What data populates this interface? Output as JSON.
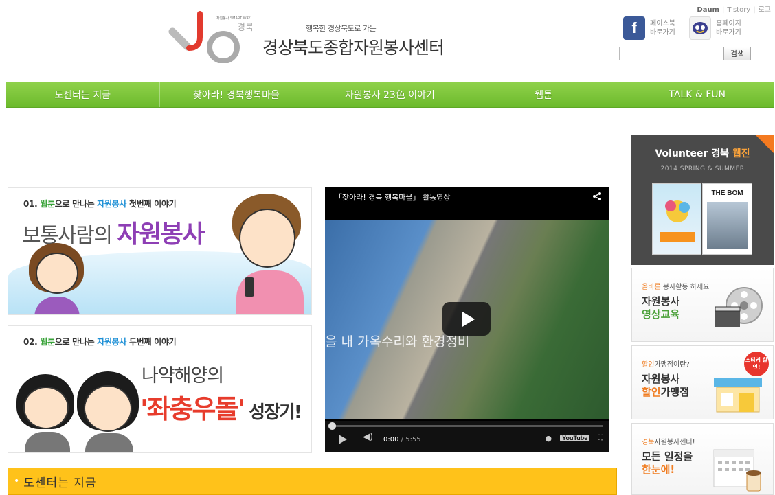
{
  "header": {
    "tagline": "행복한 경상북도로 가는",
    "title": "경상북도종합자원봉사센터",
    "logo_small": "자원봉사 SMART WAY",
    "logo_region": "경북",
    "toplinks": [
      "Daum",
      "Tistory",
      "로그"
    ],
    "facebook": {
      "line1": "페이스북",
      "line2": "바로가기"
    },
    "homepage": {
      "line1": "홈페이지",
      "line2": "바로가기"
    },
    "search": {
      "placeholder": "",
      "button": "검색"
    }
  },
  "nav": {
    "items": [
      "도센터는 지금",
      "찾아라! 경북행복마을",
      "자원봉사 23色 이야기",
      "웹툰",
      "TALK & FUN"
    ]
  },
  "banner1": {
    "num": "01.",
    "webtoon": "웹툰",
    "mid1": "으로 만나는 ",
    "volunteer": "자원봉사",
    "tail": " 첫번째 이야기",
    "headline_pre": "보통사람의 ",
    "headline_bold": "자원봉사"
  },
  "banner2": {
    "num": "02.",
    "webtoon": "웹툰",
    "mid1": "으로 만나는 ",
    "volunteer": "자원봉사",
    "tail": " 두번째 이야기",
    "sub": "나약해양의",
    "big": "'좌충우돌'",
    "big_tail": " 성장기!"
  },
  "video": {
    "title": "「찾아라! 경북 행복마을」 활동영상",
    "overlay": "을 내 가옥수리와 환경정비",
    "time_current": "0:00",
    "time_total": "/ 5:55",
    "youtube": "YouTube"
  },
  "section": {
    "label": "도센터는 지금"
  },
  "sidebar": {
    "webzine": {
      "title_pre": "Volunteer 경북 ",
      "title_accent": "웹진",
      "sub": "2014 SPRING & SUMMER",
      "mag_title": "THE BOM"
    },
    "card1": {
      "small_accent": "올바른",
      "small_rest": " 봉사활동 하세요",
      "line1": "자원봉사",
      "line2": "영상교육"
    },
    "card2": {
      "small_accent": "할인",
      "small_rest": "가맹점이란?",
      "line1": "자원봉사",
      "line2_accent": "할인",
      "line2_rest": "가맹점",
      "sticker": "스티커 할인!"
    },
    "card3": {
      "small_accent": "경북",
      "small_rest": "자원봉사센터!",
      "line1": "모든 일정을",
      "line2": "한눈에!"
    }
  },
  "colors": {
    "nav_green": "#7ac63a",
    "section_yellow": "#ffc21a",
    "accent_orange": "#f07d22",
    "accent_purple": "#8e3fb5",
    "accent_red": "#e73c2c"
  }
}
